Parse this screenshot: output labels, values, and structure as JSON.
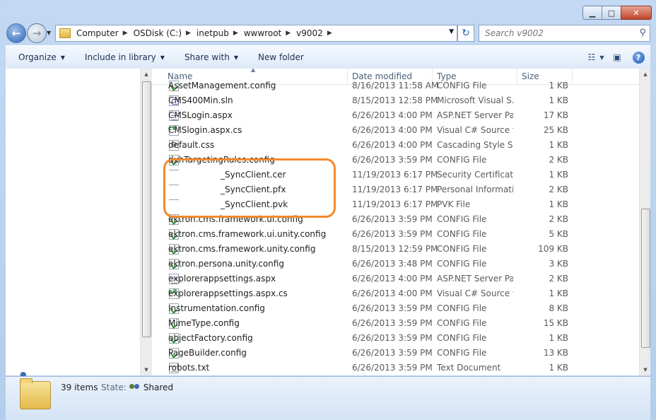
{
  "address": {
    "crumbs": [
      "Computer",
      "OSDisk (C:)",
      "inetpub",
      "wwwroot",
      "v9002"
    ]
  },
  "search": {
    "placeholder": "Search v9002"
  },
  "toolbar": {
    "organize": "Organize",
    "include_in_library": "Include in library",
    "share_with": "Share with",
    "new_folder": "New folder"
  },
  "columns": {
    "name": "Name",
    "date": "Date modified",
    "type": "Type",
    "size": "Size"
  },
  "files": [
    {
      "name": "AssetManagement.config",
      "date": "8/16/2013 11:58 AM",
      "type": "CONFIG File",
      "size": "1 KB",
      "icon": "config"
    },
    {
      "name": "CMS400Min.sln",
      "date": "8/15/2013 12:58 PM",
      "type": "Microsoft Visual S...",
      "size": "1 KB",
      "icon": "sln"
    },
    {
      "name": "CMSLogin.aspx",
      "date": "6/26/2013 4:00 PM",
      "type": "ASP.NET Server Pa...",
      "size": "17 KB",
      "icon": "aspx"
    },
    {
      "name": "CMSlogin.aspx.cs",
      "date": "6/26/2013 4:00 PM",
      "type": "Visual C# Source f...",
      "size": "25 KB",
      "icon": "cs"
    },
    {
      "name": "default.css",
      "date": "6/26/2013 4:00 PM",
      "type": "Cascading Style S...",
      "size": "1 KB",
      "icon": "css"
    },
    {
      "name": "dxhTargetingRules.config",
      "date": "6/26/2013 3:59 PM",
      "type": "CONFIG File",
      "size": "2 KB",
      "icon": "config"
    },
    {
      "name": "_SyncClient.cer",
      "date": "11/19/2013 6:17 PM",
      "type": "Security Certificate",
      "size": "1 KB",
      "icon": "cer",
      "redacted": true
    },
    {
      "name": "_SyncClient.pfx",
      "date": "11/19/2013 6:17 PM",
      "type": "Personal Informati...",
      "size": "2 KB",
      "icon": "pfx",
      "redacted": true
    },
    {
      "name": "_SyncClient.pvk",
      "date": "11/19/2013 6:17 PM",
      "type": "PVK File",
      "size": "1 KB",
      "icon": "txt",
      "redacted": true
    },
    {
      "name": "ektron.cms.framework.ui.config",
      "date": "6/26/2013 3:59 PM",
      "type": "CONFIG File",
      "size": "2 KB",
      "icon": "config"
    },
    {
      "name": "ektron.cms.framework.ui.unity.config",
      "date": "6/26/2013 3:59 PM",
      "type": "CONFIG File",
      "size": "5 KB",
      "icon": "config"
    },
    {
      "name": "ektron.cms.framework.unity.config",
      "date": "8/15/2013 12:59 PM",
      "type": "CONFIG File",
      "size": "109 KB",
      "icon": "config"
    },
    {
      "name": "ektron.persona.unity.config",
      "date": "6/26/2013 3:48 PM",
      "type": "CONFIG File",
      "size": "3 KB",
      "icon": "config"
    },
    {
      "name": "explorerappsettings.aspx",
      "date": "6/26/2013 4:00 PM",
      "type": "ASP.NET Server Pa...",
      "size": "2 KB",
      "icon": "aspx"
    },
    {
      "name": "explorerappsettings.aspx.cs",
      "date": "6/26/2013 4:00 PM",
      "type": "Visual C# Source f...",
      "size": "1 KB",
      "icon": "cs"
    },
    {
      "name": "Instrumentation.config",
      "date": "6/26/2013 3:59 PM",
      "type": "CONFIG File",
      "size": "8 KB",
      "icon": "config"
    },
    {
      "name": "MimeType.config",
      "date": "6/26/2013 3:59 PM",
      "type": "CONFIG File",
      "size": "15 KB",
      "icon": "config"
    },
    {
      "name": "objectFactory.config",
      "date": "6/26/2013 3:59 PM",
      "type": "CONFIG File",
      "size": "1 KB",
      "icon": "config"
    },
    {
      "name": "PageBuilder.config",
      "date": "6/26/2013 3:59 PM",
      "type": "CONFIG File",
      "size": "13 KB",
      "icon": "config"
    },
    {
      "name": "robots.txt",
      "date": "6/26/2013 3:59 PM",
      "type": "Text Document",
      "size": "1 KB",
      "icon": "txt"
    }
  ],
  "status": {
    "item_count": "39 items",
    "state_label": "State:",
    "state_value": "Shared"
  }
}
